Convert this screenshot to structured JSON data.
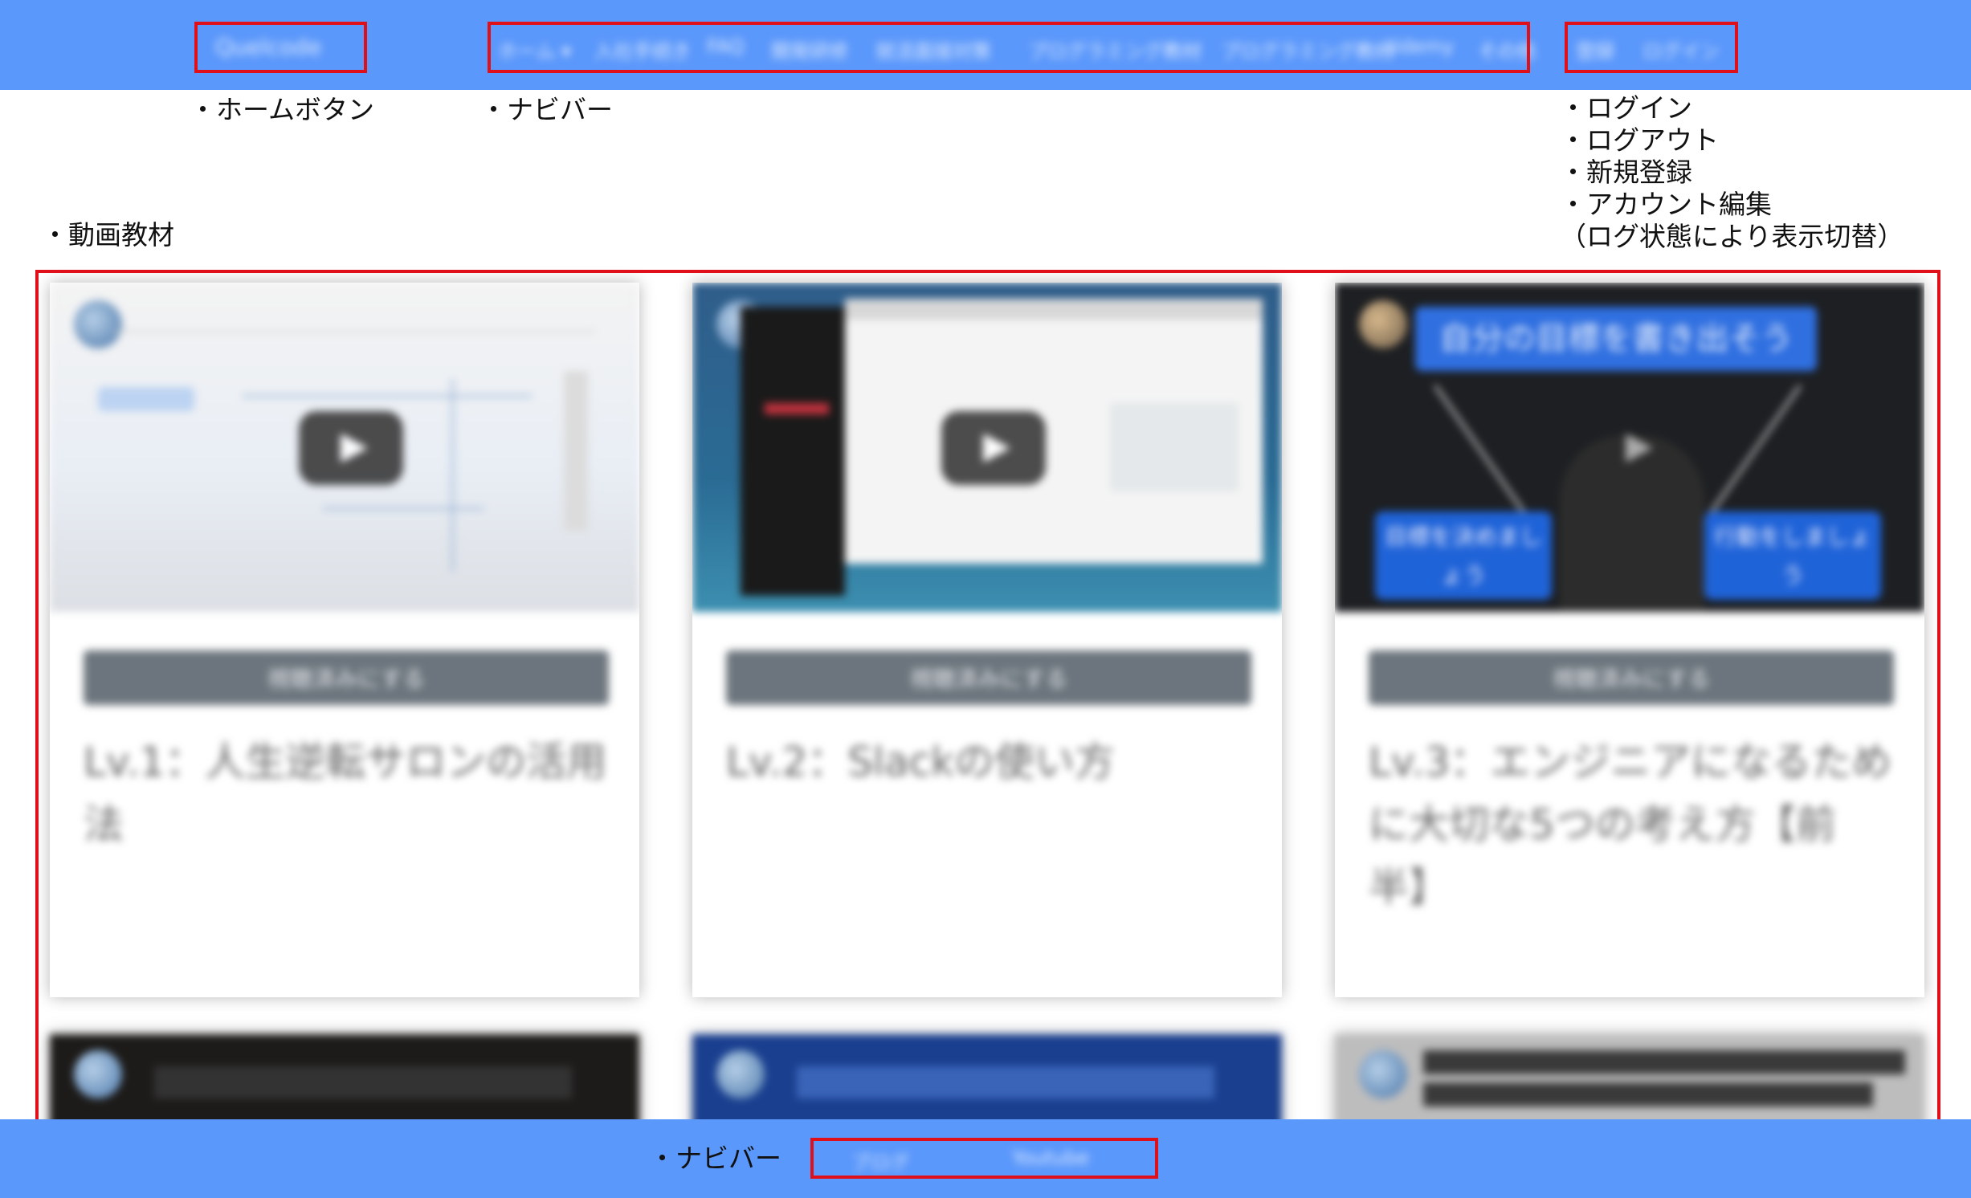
{
  "header": {
    "home_button": "Quelcode",
    "nav_items": [
      "ホーム ▾",
      "入社手続き",
      "FAQ",
      "開発研修",
      "就活面接対策",
      "プログラミング教材",
      "プログラミング教材",
      "Udemy",
      "その他"
    ],
    "auth_items": [
      "登録",
      "ログイン"
    ]
  },
  "annotations": {
    "home_button": "・ホームボタン",
    "navbar_top": "・ナビバー",
    "auth_list": [
      "・ログイン",
      "・ログアウト",
      "・新規登録",
      "・アカウント編集",
      "（ログ状態により表示切替）"
    ],
    "video_materials": "・動画教材",
    "navbar_bottom": "・ナビバー"
  },
  "cards": [
    {
      "button": "視聴済みにする",
      "title": "Lv.1：人生逆転サロンの活用法"
    },
    {
      "button": "視聴済みにする",
      "title": "Lv.2：Slackの使い方"
    },
    {
      "button": "視聴済みにする",
      "title": "Lv.3：エンジニアになるために大切な5つの考え方【前半】"
    }
  ],
  "card3_thumb_texts": {
    "heading": "自分の目標を書き出そう",
    "left": "目標を決めましょう",
    "right": "行動をしましょう"
  },
  "footer": {
    "nav_items": [
      "ブログ",
      "Youtube"
    ]
  },
  "colors": {
    "bar": "#5b98fb",
    "highlight_box": "#e0101a",
    "button": "#6c757d"
  }
}
